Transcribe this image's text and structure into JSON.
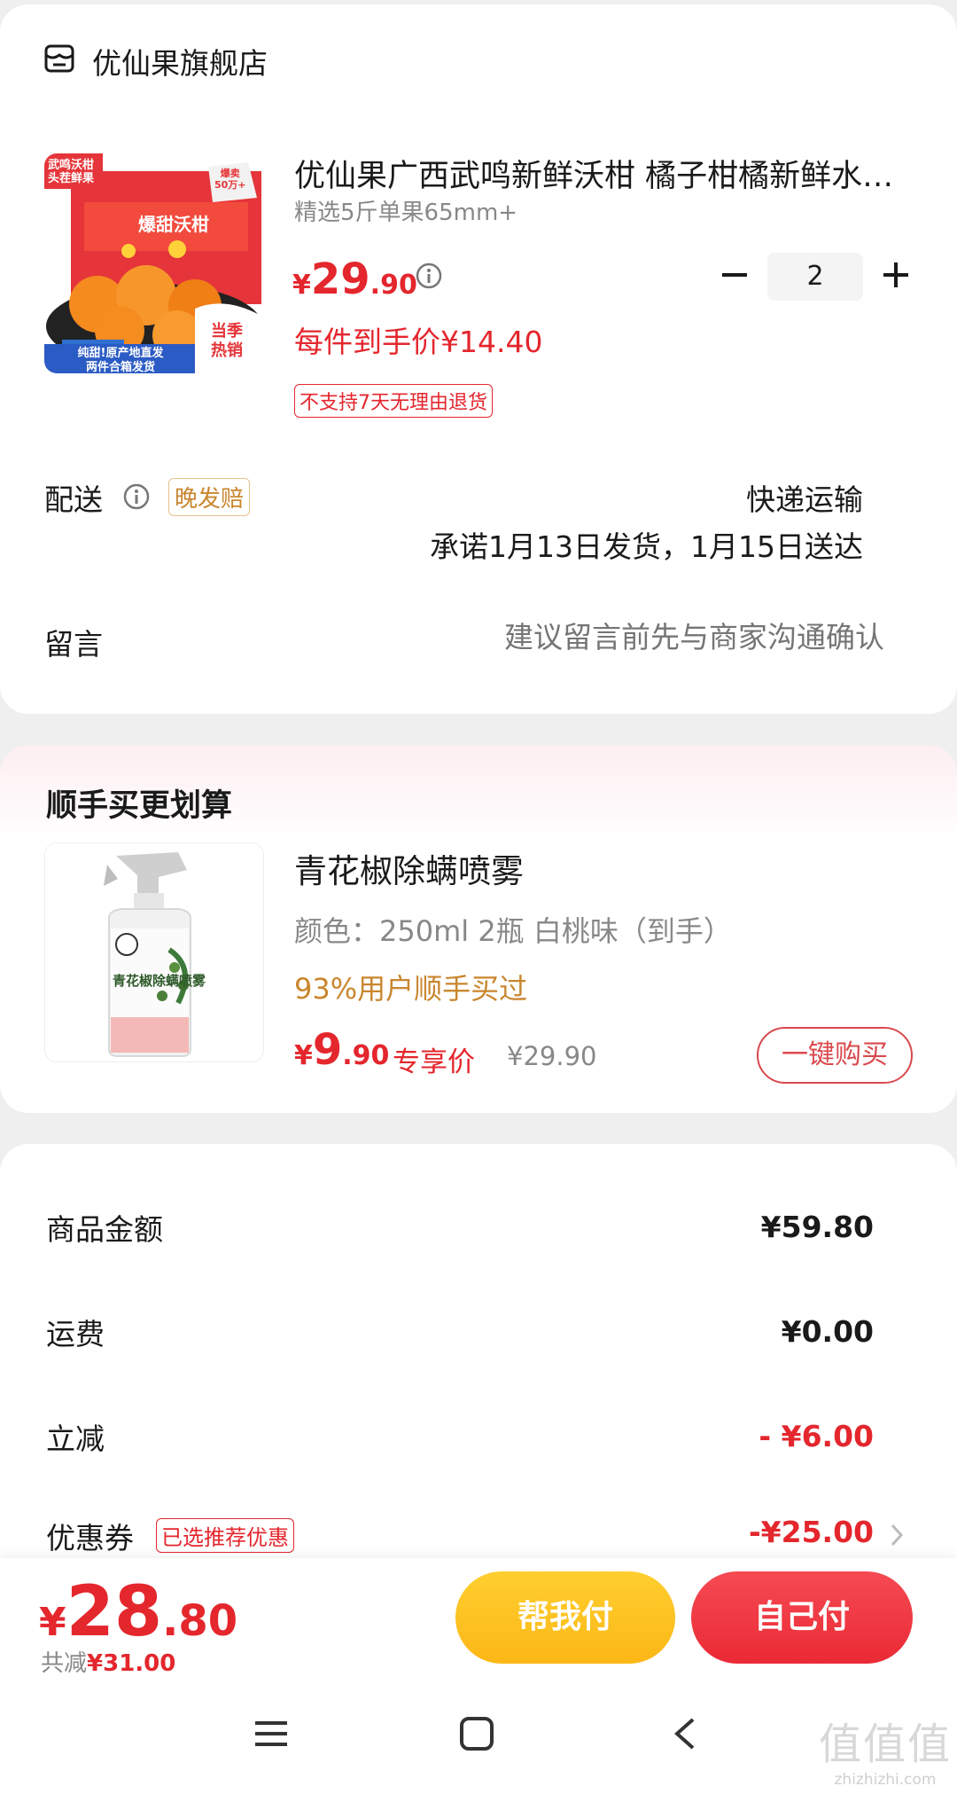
{
  "store": {
    "name": "优仙果旗舰店"
  },
  "product": {
    "title": "优仙果广西武鸣新鲜沃柑 橘子柑橘新鲜水果当季整箱",
    "spec": "精选5斤单果65mm+",
    "price_currency": "¥",
    "price_int": "29",
    "price_dec": ".90",
    "per_item_price": "每件到手价¥14.40",
    "no_return": "不支持7天无理由退货",
    "quantity": "2",
    "image_text": {
      "tl": "武鸣沃柑\n头茬鲜果",
      "tr": "爆卖\n50万+",
      "banner": "爆甜沃柑",
      "bl": "纯甜!原产地直发\n两件合箱发货",
      "br": "当季\n热销"
    }
  },
  "delivery": {
    "label": "配送",
    "late_badge": "晚发赔",
    "method": "快递运输",
    "promise": "承诺1月13日发货，1月15日送达"
  },
  "message": {
    "label": "留言",
    "placeholder": "建议留言前先与商家沟通确认"
  },
  "upsell": {
    "title": "顺手买更划算",
    "name": "青花椒除螨喷雾",
    "spec": "颜色：250ml 2瓶 白桃味（到手）",
    "social": "93%用户顺手买过",
    "price_currency": "¥",
    "price_int": "9",
    "price_dec": ".90",
    "exclusive": "专享价",
    "original": "¥29.90",
    "buy_label": "一键购买"
  },
  "summary": {
    "items": [
      {
        "label": "商品金额",
        "value": "¥59.80",
        "color": "#1a1a1a"
      },
      {
        "label": "运费",
        "value": "¥0.00",
        "color": "#1a1a1a"
      },
      {
        "label": "立减",
        "value": "- ¥6.00",
        "color": "#e4262d"
      },
      {
        "label": "优惠券",
        "value": "-¥25.00",
        "color": "#e4262d"
      }
    ],
    "coupon_badge": "已选推荐优惠"
  },
  "bottom": {
    "total_currency": "¥",
    "total_int": "28",
    "total_dec": ".80",
    "save_label": "共减",
    "save_value": "¥31.00",
    "help_pay": "帮我付",
    "self_pay": "自己付"
  },
  "watermark": {
    "big": "值值值",
    "small": "zhizhizhi.com"
  },
  "colors": {
    "accent": "#e4262d",
    "gold": "#c9862e",
    "yellow_btn": "#fbb716"
  }
}
